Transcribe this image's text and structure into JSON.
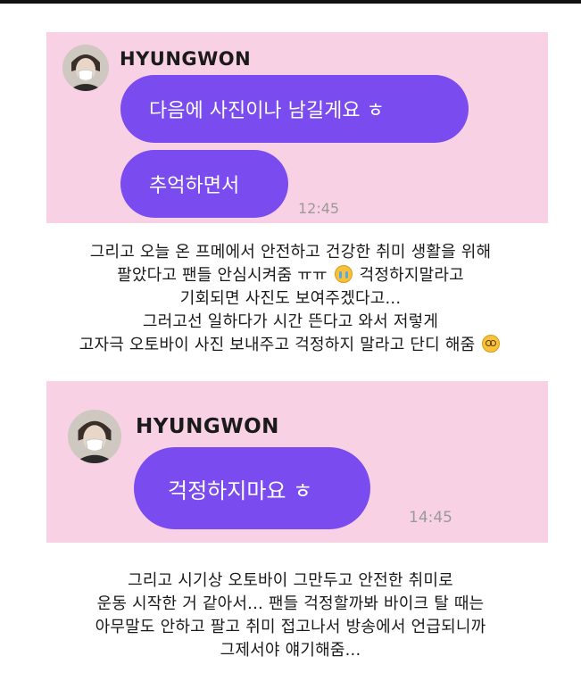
{
  "card1": {
    "sender": "HYUNGWON",
    "messages": [
      "다음에 사진이나 남길게요 ㅎ",
      "추억하면서"
    ],
    "time": "12:45"
  },
  "paragraph1": {
    "line1": "그리고 오늘 온 프메에서 안전하고 건강한 취미 생활을 위해",
    "line2a": "팔았다고 팬들 안심시켜줌 ㅠㅠ",
    "line2b": " 걱정하지말라고",
    "line3": "기회되면 사진도 보여주겠다고...",
    "line4": "그러고선 일하다가 시간 뜬다고 와서 저렇게",
    "line5": "고자극 오토바이 사진 보내주고 걱정하지 말라고 단디 해줌",
    "emoji_cry": "crying-face-emoji",
    "emoji_dizzy": "dizzy-face-emoji"
  },
  "card2": {
    "sender": "HYUNGWON",
    "messages": [
      "걱정하지마요 ㅎ"
    ],
    "time": "14:45"
  },
  "paragraph2": {
    "line1": "그리고 시기상 오토바이 그만두고 안전한 취미로",
    "line2": "운동 시작한 거 같아서... 팬들 걱정할까봐 바이크 탈 때는",
    "line3": "아무말도 안하고 팔고 취미 접고나서 방송에서 언급되니까",
    "line4": "그제서야 얘기해줌..."
  },
  "colors": {
    "card_bg": "#f9d1e4",
    "bubble": "#7a4cf0",
    "time": "#9a9a9a"
  }
}
